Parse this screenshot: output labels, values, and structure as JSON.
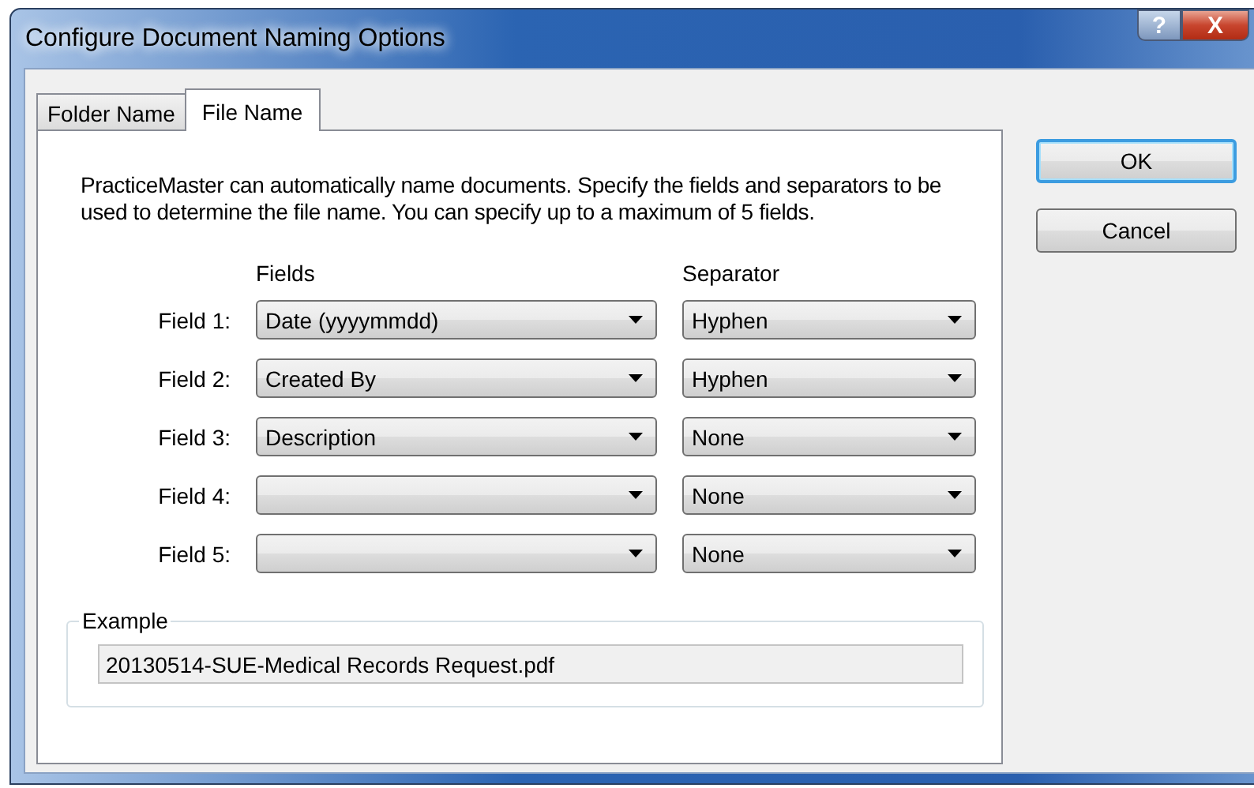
{
  "window": {
    "title": "Configure Document Naming Options",
    "controls": [
      {
        "kind": "help",
        "label": "?"
      },
      {
        "kind": "close",
        "label": "X"
      }
    ]
  },
  "tabs": [
    {
      "label": "Folder Name",
      "selected": false
    },
    {
      "label": "File Name",
      "selected": true
    }
  ],
  "description": "PracticeMaster can automatically name documents.  Specify the fields and separators to be used to determine the file name.  You can specify up to a maximum of 5 fields.",
  "headers": {
    "fields": "Fields",
    "separator": "Separator"
  },
  "rows": [
    {
      "label": "Field 1:",
      "field": "Date (yyyymmdd)",
      "separator": "Hyphen"
    },
    {
      "label": "Field 2:",
      "field": "Created By",
      "separator": "Hyphen"
    },
    {
      "label": "Field 3:",
      "field": "Description",
      "separator": "None"
    },
    {
      "label": "Field 4:",
      "separator": "None"
    },
    {
      "label": "Field 5:",
      "separator": "None"
    }
  ],
  "example": {
    "label": "Example",
    "value": "20130514-SUE-Medical Records Request.pdf"
  },
  "buttons": [
    {
      "label": "OK",
      "default": true
    },
    {
      "label": "Cancel",
      "default": false
    }
  ]
}
